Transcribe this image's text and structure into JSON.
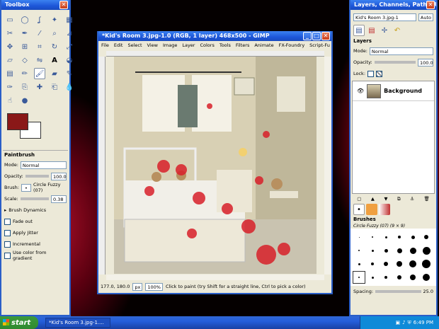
{
  "toolbox": {
    "title": "Toolbox"
  },
  "tool_options": {
    "tool_name": "Paintbrush",
    "mode_label": "Mode:",
    "mode_value": "Normal",
    "opacity_label": "Opacity:",
    "opacity_value": "100.0",
    "brush_label": "Brush:",
    "brush_value": "Circle Fuzzy (07)",
    "scale_label": "Scale:",
    "scale_value": "0.38",
    "dynamics_label": "Brush Dynamics",
    "fade_out": "Fade out",
    "apply_jitter": "Apply Jitter",
    "incremental": "Incremental",
    "use_gradient": "Use color from gradient"
  },
  "image_window": {
    "title": "*Kid's Room 3.jpg-1.0 (RGB, 1 layer) 468x500 - GIMP",
    "menu": [
      "File",
      "Edit",
      "Select",
      "View",
      "Image",
      "Layer",
      "Colors",
      "Tools",
      "Filters",
      "Animate",
      "FX-Foundry",
      "Script-Fu"
    ],
    "coords": "177.0, 180.0",
    "unit": "px",
    "zoom": "100%",
    "status": "Click to paint (try Shift for a straight line, Ctrl to pick a color)"
  },
  "layers_dock": {
    "title": "Layers, Channels, Paths, Undo",
    "image_select": "Kid's Room 3.jpg-1",
    "auto_label": "Auto",
    "panel_title": "Layers",
    "mode_label": "Mode:",
    "mode_value": "Normal",
    "opacity_label": "Opacity:",
    "opacity_value": "100.0",
    "lock_label": "Lock:",
    "layer_name": "Background",
    "brushes_title": "Brushes",
    "brush_selected": "Circle Fuzzy (07) (9 × 9)",
    "spacing_label": "Spacing:",
    "spacing_value": "25.0"
  },
  "taskbar": {
    "start_label": "start",
    "task_label": "*Kid's Room 3.jpg-1....",
    "clock": "6:49 PM"
  }
}
